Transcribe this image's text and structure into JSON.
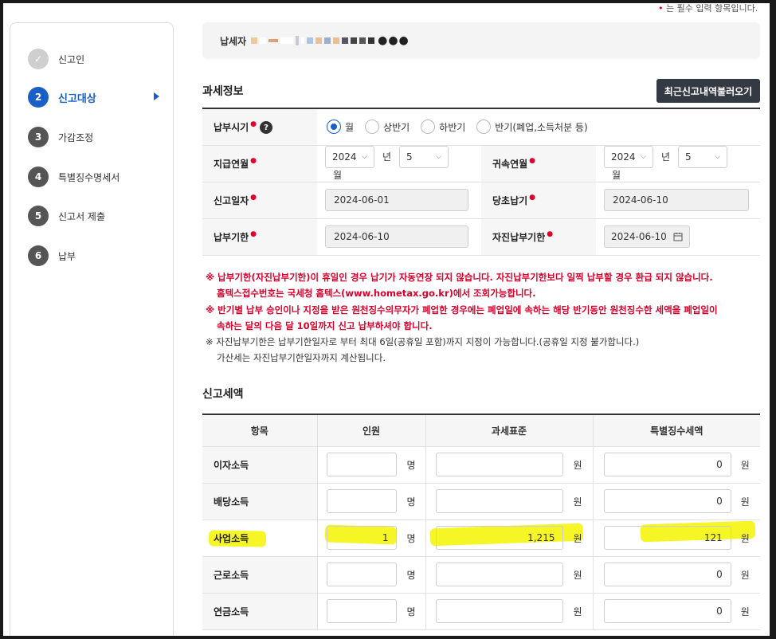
{
  "required_note": "는 필수 입력 항목입니다.",
  "sidebar": {
    "steps": [
      {
        "num": "✓",
        "label": "신고인"
      },
      {
        "num": "2",
        "label": "신고대상"
      },
      {
        "num": "3",
        "label": "가감조정"
      },
      {
        "num": "4",
        "label": "특별징수명세서"
      },
      {
        "num": "5",
        "label": "신고서 제출"
      },
      {
        "num": "6",
        "label": "납부"
      }
    ]
  },
  "taxpayer": {
    "label": "납세자",
    "masked": "●●●"
  },
  "tax_info": {
    "title": "과세정보",
    "recall_button": "최근신고내역불러오기",
    "pay_period_label": "납부시기",
    "radios": [
      "월",
      "상반기",
      "하반기",
      "반기(폐업,소득처분 등)"
    ],
    "pay_month_label": "지급연월",
    "pay_year": "2024",
    "pay_month": "5",
    "year_unit": "년",
    "month_unit": "월",
    "belong_month_label": "귀속연월",
    "belong_year": "2024",
    "belong_month": "5",
    "report_date_label": "신고일자",
    "report_date": "2024-06-01",
    "orig_due_label": "당초납기",
    "orig_due": "2024-06-10",
    "due_label": "납부기한",
    "due": "2024-06-10",
    "self_due_label": "자진납부기한",
    "self_due": "2024-06-10"
  },
  "notes": {
    "n1": "※ 납부기한(자진납부기한)이 휴일인 경우 납기가 자동연장 되지 않습니다. 자진납부기한보다 일찍 납부할 경우 환급 되지 않습니다.",
    "n1b": "홈텍스접수번호는 국세청 홈텍스(www.hometax.go.kr)에서 조회가능합니다.",
    "n2": "※ 반기별 납부 승인이나 지정을 받은 원천징수의무자가 폐업한 경우에는 폐업일에 속하는 해당 반기동안 원천징수한 세액을 폐업일이",
    "n2b": "속하는 달의 다음 달 10일까지 신고 납부하셔야 합니다.",
    "n3": "※ 자진납부기한은 납부기한일자로 부터 최대 6일(공휴일 포함)까지 지정이 가능합니다.(공휴일 지정 불가합니다.)",
    "n3b": "가산세는 자진납부기한일자까지 계산됩니다."
  },
  "amount": {
    "title": "신고세액",
    "headers": [
      "항목",
      "인원",
      "과세표준",
      "특별징수세액"
    ],
    "person_unit": "명",
    "won_unit": "원",
    "rows": [
      {
        "item": "이자소득",
        "persons": "",
        "base": "",
        "tax": "0"
      },
      {
        "item": "배당소득",
        "persons": "",
        "base": "",
        "tax": "0"
      },
      {
        "item": "사업소득",
        "persons": "1",
        "base": "1,215",
        "tax": "121"
      },
      {
        "item": "근로소득",
        "persons": "",
        "base": "",
        "tax": "0"
      },
      {
        "item": "연금소득",
        "persons": "",
        "base": "",
        "tax": "0"
      }
    ]
  },
  "colors": {
    "accent": "#1a5fc8",
    "required": "#e0002a",
    "highlight": "#f5f500"
  }
}
